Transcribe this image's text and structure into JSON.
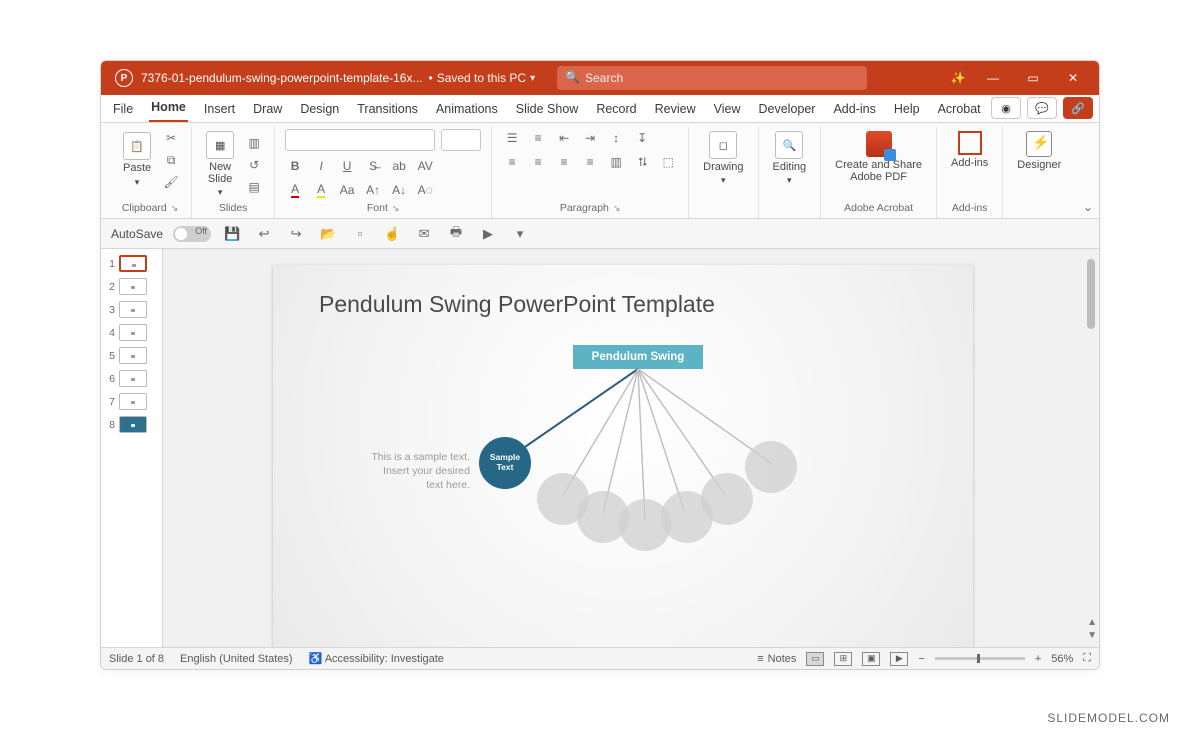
{
  "titlebar": {
    "doc_name": "7376-01-pendulum-swing-powerpoint-template-16x...",
    "saved_status": "Saved to this PC",
    "search_placeholder": "Search"
  },
  "tabs": [
    "File",
    "Home",
    "Insert",
    "Draw",
    "Design",
    "Transitions",
    "Animations",
    "Slide Show",
    "Record",
    "Review",
    "View",
    "Developer",
    "Add-ins",
    "Help",
    "Acrobat"
  ],
  "active_tab": "Home",
  "ribbon": {
    "clipboard": {
      "paste": "Paste",
      "label": "Clipboard"
    },
    "slides": {
      "new_slide": "New\nSlide",
      "label": "Slides"
    },
    "font": {
      "label": "Font"
    },
    "paragraph": {
      "label": "Paragraph"
    },
    "drawing": {
      "btn": "Drawing",
      "label": ""
    },
    "editing": {
      "btn": "Editing",
      "label": ""
    },
    "adobe": {
      "btn": "Create and Share\nAdobe PDF",
      "label": "Adobe Acrobat"
    },
    "addins": {
      "btn": "Add-ins",
      "label": "Add-ins"
    },
    "designer": {
      "btn": "Designer"
    }
  },
  "qat": {
    "autosave": "AutoSave",
    "autosave_state": "Off"
  },
  "thumbnails": [
    1,
    2,
    3,
    4,
    5,
    6,
    7,
    8
  ],
  "selected_slide": 1,
  "slide": {
    "title": "Pendulum Swing PowerPoint Template",
    "label": "Pendulum Swing",
    "sample_line1": "This is a sample text.",
    "sample_line2": "Insert your desired",
    "sample_line3": "text here.",
    "ball_text": "Sample\nText"
  },
  "status": {
    "slide_of": "Slide 1 of 8",
    "language": "English (United States)",
    "accessibility": "Accessibility: Investigate",
    "notes": "Notes",
    "zoom": "56%"
  },
  "watermark": "SLIDEMODEL.COM"
}
